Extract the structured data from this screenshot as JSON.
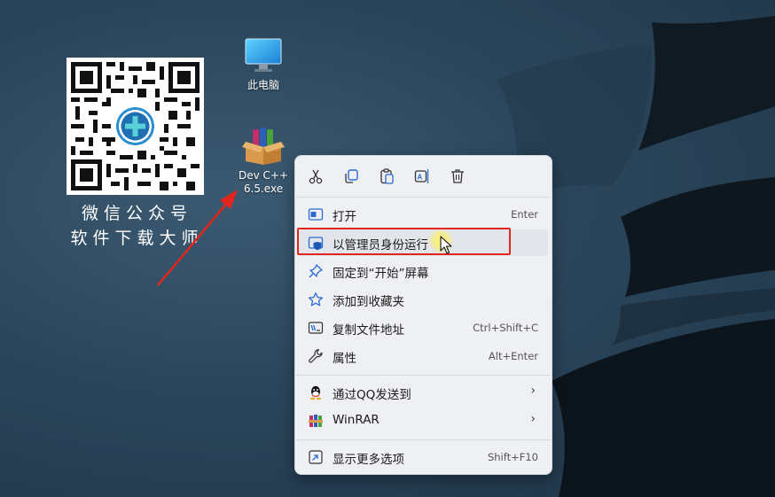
{
  "desktop": {
    "qr_caption_line1": "微信公众号",
    "qr_caption_line2": "软件下载大师",
    "icons": [
      {
        "label": "此电脑"
      },
      {
        "label_line1": "Dev C++",
        "label_line2": "6.5.exe"
      }
    ]
  },
  "menu": {
    "quick_actions": [
      "cut-icon",
      "copy-icon",
      "paste-icon",
      "rename-icon",
      "delete-icon"
    ],
    "items": [
      {
        "label": "打开",
        "shortcut": "Enter",
        "icon": "open-icon"
      },
      {
        "label": "以管理员身份运行",
        "shortcut": "",
        "icon": "shield-icon"
      },
      {
        "label": "固定到“开始”屏幕",
        "shortcut": "",
        "icon": "pin-icon"
      },
      {
        "label": "添加到收藏夹",
        "shortcut": "",
        "icon": "star-icon"
      },
      {
        "label": "复制文件地址",
        "shortcut": "Ctrl+Shift+C",
        "icon": "copy-path-icon"
      },
      {
        "label": "属性",
        "shortcut": "Alt+Enter",
        "icon": "wrench-icon"
      },
      {
        "label": "通过QQ发送到",
        "shortcut": "",
        "icon": "qq-icon"
      },
      {
        "label": "WinRAR",
        "shortcut": "",
        "icon": "winrar-icon"
      },
      {
        "label": "显示更多选项",
        "shortcut": "Shift+F10",
        "icon": "more-options-icon"
      }
    ]
  },
  "colors": {
    "highlight_box": "#e3261d",
    "arrow": "#e3261d",
    "accent": "#1a73e8"
  }
}
